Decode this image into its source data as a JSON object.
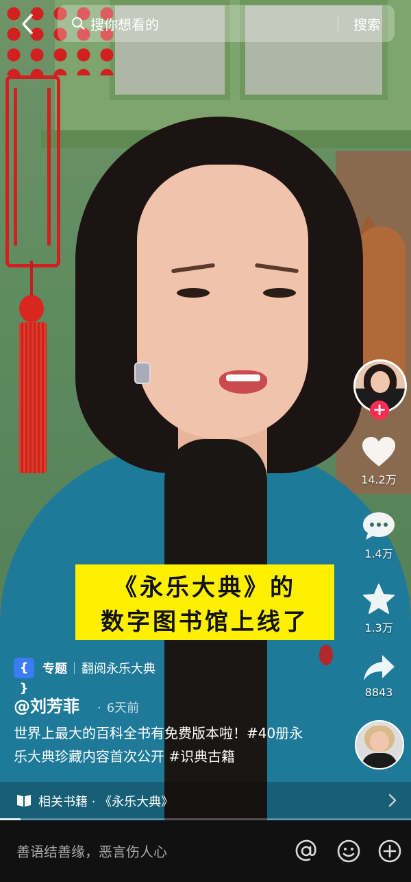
{
  "search": {
    "placeholder": "搜你想看的",
    "button_label": "搜索"
  },
  "caption": {
    "line1": "《永乐大典》的",
    "line2": "数字图书馆上线了"
  },
  "actions": {
    "like_count": "14.2万",
    "comment_count": "1.4万",
    "favorite_count": "1.3万",
    "share_count": "8843"
  },
  "topic": {
    "label": "专题",
    "name": "翻阅永乐大典"
  },
  "post": {
    "author": "@刘芳菲",
    "time": "6天前",
    "description": "世界上最大的百科全书有免费版本啦！#40册永乐大典珍藏内容首次公开 #识典古籍"
  },
  "related": {
    "text": "相关书籍 · 《永乐大典》"
  },
  "playback": {
    "progress": 0.05
  },
  "comment": {
    "placeholder": "善语结善缘，恶言伤人心"
  },
  "colors": {
    "caption_bg": "#fff000",
    "follow_accent": "#fe2c55",
    "topic_icon": "#3b7cf5"
  },
  "icons": [
    "back-icon",
    "search-icon",
    "heart-icon",
    "comment-icon",
    "star-icon",
    "share-icon",
    "book-icon",
    "chevron-right-icon",
    "at-icon",
    "emoji-icon",
    "plus-icon"
  ]
}
